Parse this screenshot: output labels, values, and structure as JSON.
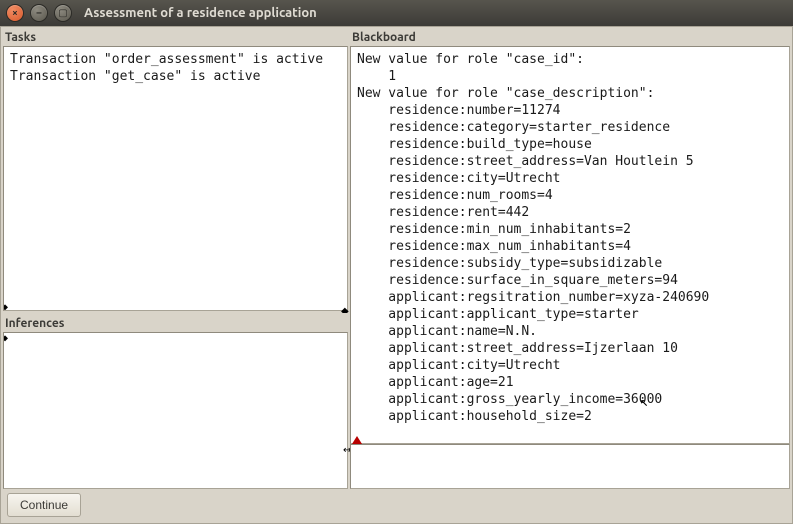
{
  "window": {
    "title": "Assessment of a residence application"
  },
  "panels": {
    "tasks": {
      "label": "Tasks",
      "content": "Transaction \"order_assessment\" is active\nTransaction \"get_case\" is active"
    },
    "inferences": {
      "label": "Inferences",
      "content": ""
    },
    "blackboard": {
      "label": "Blackboard",
      "content": "New value for role \"case_id\":\n    1\nNew value for role \"case_description\":\n    residence:number=11274\n    residence:category=starter_residence\n    residence:build_type=house\n    residence:street_address=Van Houtlein 5\n    residence:city=Utrecht\n    residence:num_rooms=4\n    residence:rent=442\n    residence:min_num_inhabitants=2\n    residence:max_num_inhabitants=4\n    residence:subsidy_type=subsidizable\n    residence:surface_in_square_meters=94\n    applicant:regsitration_number=xyza-240690\n    applicant:applicant_type=starter\n    applicant:name=N.N.\n    applicant:street_address=Ijzerlaan 10\n    applicant:city=Utrecht\n    applicant:age=21\n    applicant:gross_yearly_income=36000\n    applicant:household_size=2"
    }
  },
  "footer": {
    "continue_label": "Continue"
  },
  "glyphs": {
    "close": "×",
    "min": "–",
    "max": "▢",
    "diamond": "◆",
    "hsplit": "↔"
  }
}
